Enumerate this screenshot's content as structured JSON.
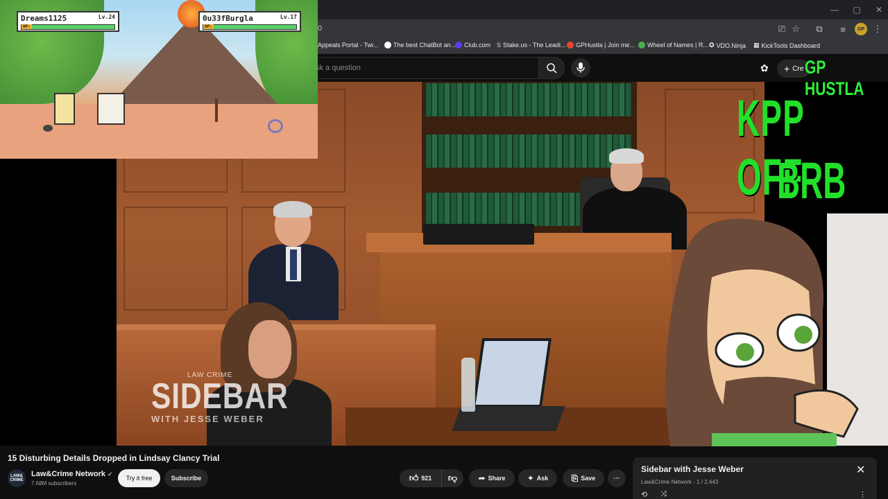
{
  "browser": {
    "address_text": "0",
    "window_controls": [
      "—",
      "▢",
      "✕"
    ],
    "bookmarks": [
      {
        "label": "Appeals Portal - Twi...",
        "color": "#ffffff"
      },
      {
        "label": "The best ChatBot an...",
        "color": "#ffffff"
      },
      {
        "label": "Club.com",
        "color": "#5b3df5"
      },
      {
        "label": "Stake.us - The Leadi...",
        "color": "#c9c9c9"
      },
      {
        "label": "GPHustla | Join me...",
        "color": "#e8472e"
      },
      {
        "label": "Wheel of Names | R...",
        "color": "#4caf50"
      },
      {
        "label": "VDO.Ninja",
        "color": "#ffffff"
      },
      {
        "label": "KickTools Dashboard",
        "color": "#ffffff"
      }
    ],
    "profile_badge": "GP"
  },
  "masthead": {
    "search_placeholder": "sk a question",
    "create_label": "Cre"
  },
  "video": {
    "logo_small": "LAW CRIME",
    "logo_big": "SIDEBAR",
    "logo_with": "WITH JESSE WEBER"
  },
  "game": {
    "player1": {
      "name": "Dreams1125",
      "level": "Lv.24",
      "hp_tag": "HP:"
    },
    "player2": {
      "name": "0u33fBurgla",
      "level": "Lv.17",
      "hp_tag": "HP:"
    }
  },
  "overlay": {
    "brand": "GP HUSTLA",
    "line1": "KPP OFF",
    "line2": "BRB"
  },
  "below": {
    "title": "15 Disturbing Details Dropped in Lindsay Clancy Trial",
    "channel_name": "Law&Crime Network",
    "channel_avatar_text": "LAW& CRIME",
    "subscribers": "7.68M subscribers",
    "try_label": "Try it free",
    "subscribe_label": "Subscribe",
    "likes": "921",
    "share_label": "Share",
    "ask_label": "Ask",
    "save_label": "Save",
    "more_label": "···"
  },
  "playlist": {
    "title": "Sidebar with Jesse Weber",
    "owner": "Law&Crime Network",
    "position": "1 / 2,443"
  },
  "colors": {
    "overlay_green": "#22e02a",
    "background": "#0f0f0f"
  }
}
